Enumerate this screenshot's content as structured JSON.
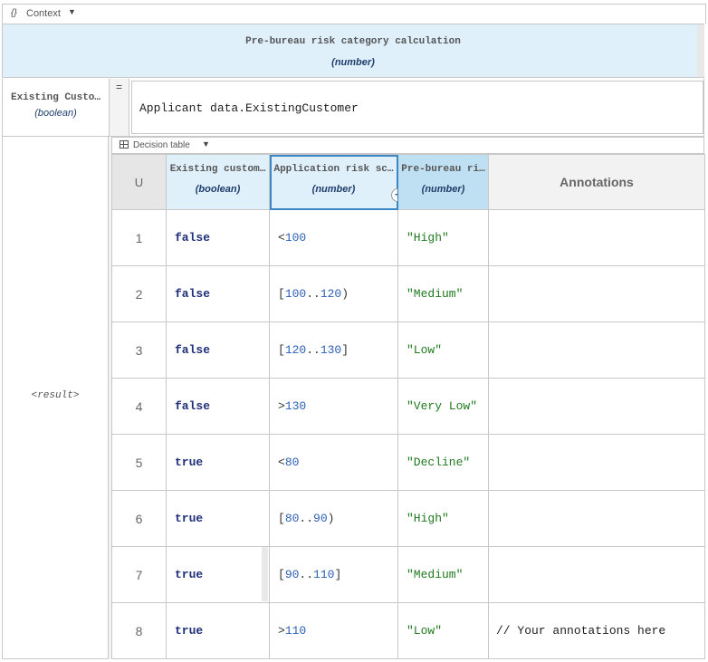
{
  "context_bar": {
    "icon": "{}",
    "label": "Context",
    "caret": "▼"
  },
  "context_result": {
    "name": "Pre-bureau risk category calculation",
    "type": "(number)"
  },
  "entry": {
    "name": "Existing Custo…",
    "type": "(boolean)",
    "operator": "=",
    "expression": "Applicant data.ExistingCustomer"
  },
  "result_label": "<result>",
  "decision_table_bar": {
    "label": "Decision table",
    "caret": "▼"
  },
  "table": {
    "hit_policy": "U",
    "inputs": [
      {
        "name": "Existing custom…",
        "type": "(boolean)"
      },
      {
        "name": "Application risk sc…",
        "type": "(number)"
      }
    ],
    "output": {
      "name": "Pre-bureau ri…",
      "type": "(number)"
    },
    "annotations_header": "Annotations",
    "rules": [
      {
        "n": "1",
        "existing": "false",
        "risk": {
          "pre": "<",
          "a": "100"
        },
        "out": "\"High\"",
        "ann": ""
      },
      {
        "n": "2",
        "existing": "false",
        "risk": {
          "pre": "[",
          "a": "100",
          "sep": "..",
          "b": "120",
          "post": ")"
        },
        "out": "\"Medium\"",
        "ann": ""
      },
      {
        "n": "3",
        "existing": "false",
        "risk": {
          "pre": "[",
          "a": "120",
          "sep": "..",
          "b": "130",
          "post": "]"
        },
        "out": "\"Low\"",
        "ann": ""
      },
      {
        "n": "4",
        "existing": "false",
        "risk": {
          "pre": ">",
          "a": "130"
        },
        "out": "\"Very Low\"",
        "ann": ""
      },
      {
        "n": "5",
        "existing": "true",
        "risk": {
          "pre": "<",
          "a": "80"
        },
        "out": "\"Decline\"",
        "ann": ""
      },
      {
        "n": "6",
        "existing": "true",
        "risk": {
          "pre": "[",
          "a": "80",
          "sep": "..",
          "b": "90",
          "post": ")"
        },
        "out": "\"High\"",
        "ann": ""
      },
      {
        "n": "7",
        "existing": "true",
        "risk": {
          "pre": "[",
          "a": "90",
          "sep": "..",
          "b": "110",
          "post": "]"
        },
        "out": "\"Medium\"",
        "ann": ""
      },
      {
        "n": "8",
        "existing": "true",
        "risk": {
          "pre": ">",
          "a": "110"
        },
        "out": "\"Low\"",
        "ann": "// Your annotations here"
      }
    ]
  }
}
